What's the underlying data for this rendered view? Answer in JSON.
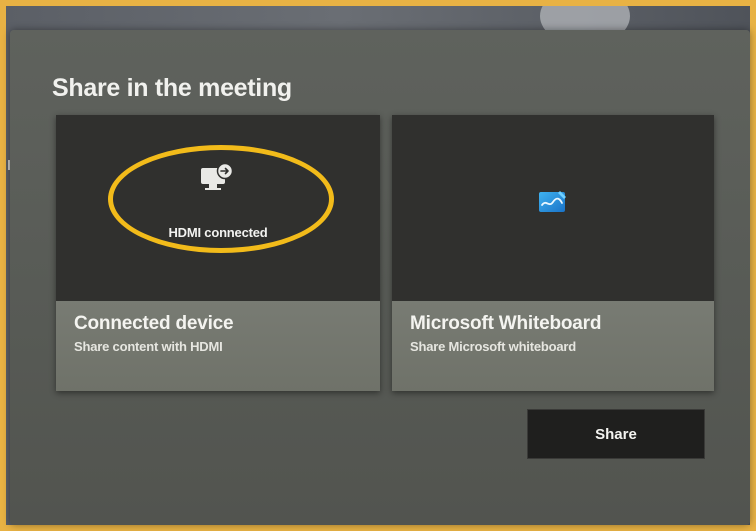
{
  "dialog": {
    "title": "Share in the meeting"
  },
  "cards": [
    {
      "preview_label": "HDMI connected",
      "preview_icon": "hdmi-display-icon",
      "title": "Connected device",
      "subtitle": "Share content with HDMI",
      "highlighted": true
    },
    {
      "preview_icon": "whiteboard-icon",
      "title": "Microsoft Whiteboard",
      "subtitle": "Share Microsoft whiteboard"
    }
  ],
  "actions": {
    "share_label": "Share"
  },
  "colors": {
    "highlight": "#f2bb1a",
    "frame": "#e8b244",
    "dialog_bg": "#5b5e59",
    "card_preview_bg": "#30302e",
    "card_footer_bg": "#747770",
    "button_bg": "#1f1f1e"
  }
}
